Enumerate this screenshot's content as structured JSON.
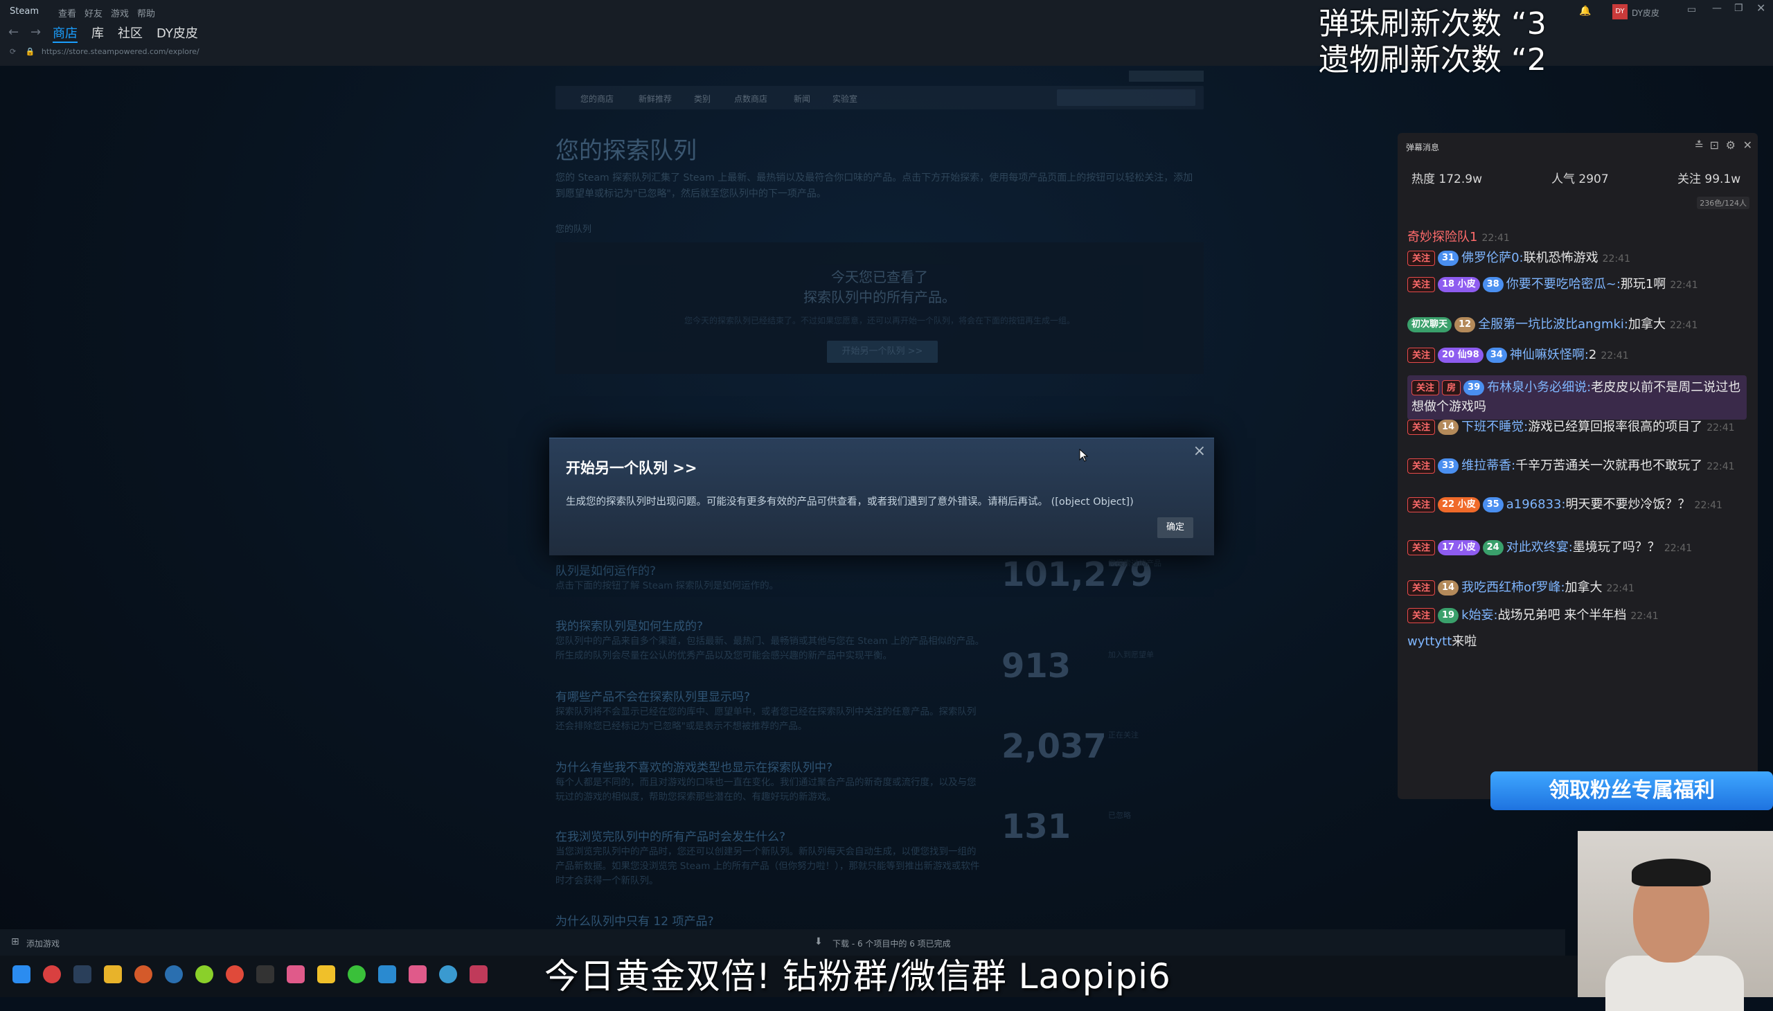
{
  "steam": {
    "logo": "Steam",
    "menu": [
      "查看",
      "好友",
      "游戏",
      "帮助"
    ],
    "tabs": [
      "商店",
      "库",
      "社区",
      "DY皮皮"
    ],
    "url": "https://store.steampowered.com/explore/",
    "user": "DY皮皮"
  },
  "store": {
    "nav": [
      "您的商店",
      "新鲜推荐",
      "类别",
      "点数商店",
      "新闻",
      "实验室"
    ],
    "title": "您的探索队列",
    "intro": "您的 Steam 探索队列汇集了 Steam 上最新、最热销以及最符合你口味的产品。点击下方开始探索，使用每项产品页面上的按钮可以轻松关注，添加到愿望单或标记为\"已忽略\"，然后就至您队列中的下一项产品。",
    "queue_label": "您的队列",
    "queue_msg1": "今天您已查看了",
    "queue_msg2": "探索队列中的所有产品。",
    "queue_sub": "您今天的探索队列已经结束了。不过如果您愿意，还可以再开始一个队列，将会在下面的按钮再生成一组。",
    "queue_btn": "开始另一个队列 >>"
  },
  "modal": {
    "title": "开始另一个队列 >>",
    "message": "生成您的探索队列时出现问题。可能没有更多有效的产品可供查看，或者我们遇到了意外错误。请稍后再试。 ([object Object])",
    "ok": "确定",
    "close": "×"
  },
  "faq": [
    {
      "q": "队列是如何运作的?",
      "a": "点击下面的按钮了解 Steam 探索队列是如何运作的。"
    },
    {
      "q": "我的探索队列是如何生成的?",
      "a": "您队列中的产品来自多个渠道，包括最新、最热门、最畅销或其他与您在 Steam 上的产品相似的产品。所生成的队列会尽量在公认的优秀产品以及您可能会感兴趣的新产品中实现平衡。"
    },
    {
      "q": "有哪些产品不会在探索队列里显示吗?",
      "a": "探索队列将不会显示已经在您的库中、愿望单中，或者您已经在探索队列中关注的任意产品。探索队列还会排除您已经标记为\"已忽略\"或是表示不想被推荐的产品。"
    },
    {
      "q": "为什么有些我不喜欢的游戏类型也显示在探索队列中?",
      "a": "每个人都是不同的，而且对游戏的口味也一直在变化。我们通过聚合产品的新奇度或流行度，以及与您玩过的游戏的相似度，帮助您探索那些潜在的、有趣好玩的新游戏。"
    },
    {
      "q": "在我浏览完队列中的所有产品时会发生什么?",
      "a": "当您浏览完队列中的产品时，您还可以创建另一个新队列。新队列每天会自动生成，以便您找到一组的产品新数据。如果您没浏览完 Steam 上的所有产品（但你努力啦！），那就只能等到推出新游戏或软件时才会获得一个新队列。"
    },
    {
      "q": "为什么队列中只有 12 项产品?",
      "a": ""
    }
  ],
  "stats": [
    {
      "num": "101,279",
      "label": "您探索过的产品"
    },
    {
      "num": "913",
      "label": "加入到愿望单"
    },
    {
      "num": "2,037",
      "label": "正在关注"
    },
    {
      "num": "131",
      "label": "已忽略"
    }
  ],
  "bottom": {
    "add_game": "添加游戏",
    "download": "下载 - 6 个项目中的 6 项已完成"
  },
  "overlay": {
    "line1": "弹珠刷新次数 “3",
    "line2": "遗物刷新次数 “2",
    "subtitle": "今日黄金双倍! 钻粉群/微信群 Laopipi6",
    "fan_button": "领取粉丝专属福利"
  },
  "danmaku": {
    "title": "弹幕消息",
    "heat": "热度 172.9w",
    "popularity": "人气 2907",
    "follow": "关注 99.1w",
    "counter": "236色/124人",
    "messages": [
      {
        "name": "奇妙探险队1",
        "text": "",
        "time": "22:41",
        "badges": []
      },
      {
        "name": "佛罗伦萨0:",
        "text": "联机恐怖游戏",
        "time": "22:41",
        "badges": [
          [
            "关注",
            "red"
          ],
          [
            "31",
            "lv"
          ]
        ]
      },
      {
        "name": "你要不要吃哈密瓜~:",
        "text": "那玩1啊",
        "time": "22:41",
        "badges": [
          [
            "关注",
            "red"
          ],
          [
            "18 小皮",
            "pur"
          ],
          [
            "38",
            "lv"
          ]
        ]
      },
      {
        "name": "全服第一坑比波比angmki:",
        "text": "加拿大",
        "time": "22:41",
        "badges": [
          [
            "初次聊天",
            "grn"
          ],
          [
            "12",
            "brn"
          ]
        ]
      },
      {
        "name": "神仙嘛妖怪啊:",
        "text": "2",
        "time": "22:41",
        "badges": [
          [
            "关注",
            "red"
          ],
          [
            "20 仙98",
            "pur"
          ],
          [
            "34",
            "lv"
          ]
        ]
      },
      {
        "name": "布林泉小务必细说:",
        "text": "老皮皮以前不是周二说过也想做个游戏吗",
        "time": "",
        "badges": [
          [
            "关注",
            "red"
          ],
          [
            "房",
            "red"
          ],
          [
            "39",
            "lv"
          ]
        ]
      },
      {
        "name": "下班不睡觉:",
        "text": "游戏已经算回报率很高的项目了",
        "time": "22:41",
        "badges": [
          [
            "关注",
            "red"
          ],
          [
            "14",
            "brn"
          ]
        ]
      },
      {
        "name": "维拉蒂香:",
        "text": "千辛万苦通关一次就再也不敢玩了",
        "time": "22:41",
        "badges": [
          [
            "关注",
            "red"
          ],
          [
            "33",
            "lv"
          ]
        ]
      },
      {
        "name": "a196833:",
        "text": "明天要不要炒冷饭？？",
        "time": "22:41",
        "badges": [
          [
            "关注",
            "red"
          ],
          [
            "22 小皮",
            "or"
          ],
          [
            "35",
            "lv"
          ]
        ]
      },
      {
        "name": "对此欢终宴:",
        "text": "墨境玩了吗？？",
        "time": "22:41",
        "badges": [
          [
            "关注",
            "red"
          ],
          [
            "17 小皮",
            "pur"
          ],
          [
            "24",
            "grn"
          ]
        ]
      },
      {
        "name": "我吃西红柿of罗峰:",
        "text": "加拿大",
        "time": "22:41",
        "badges": [
          [
            "关注",
            "red"
          ],
          [
            "14",
            "brn"
          ]
        ]
      },
      {
        "name": "k始妄:",
        "text": "战场兄弟吧 来个半年档",
        "time": "22:41",
        "badges": [
          [
            "关注",
            "red"
          ],
          [
            "19",
            "grn"
          ]
        ]
      },
      {
        "name": "wyttytt",
        "text": "来啦",
        "time": "",
        "badges": []
      }
    ]
  },
  "colors": {
    "steam_bg": "#171d25",
    "modal_bg": "#2a3f5a",
    "accent": "#1a9fff",
    "danmaku_bg": "#1e1e22"
  }
}
